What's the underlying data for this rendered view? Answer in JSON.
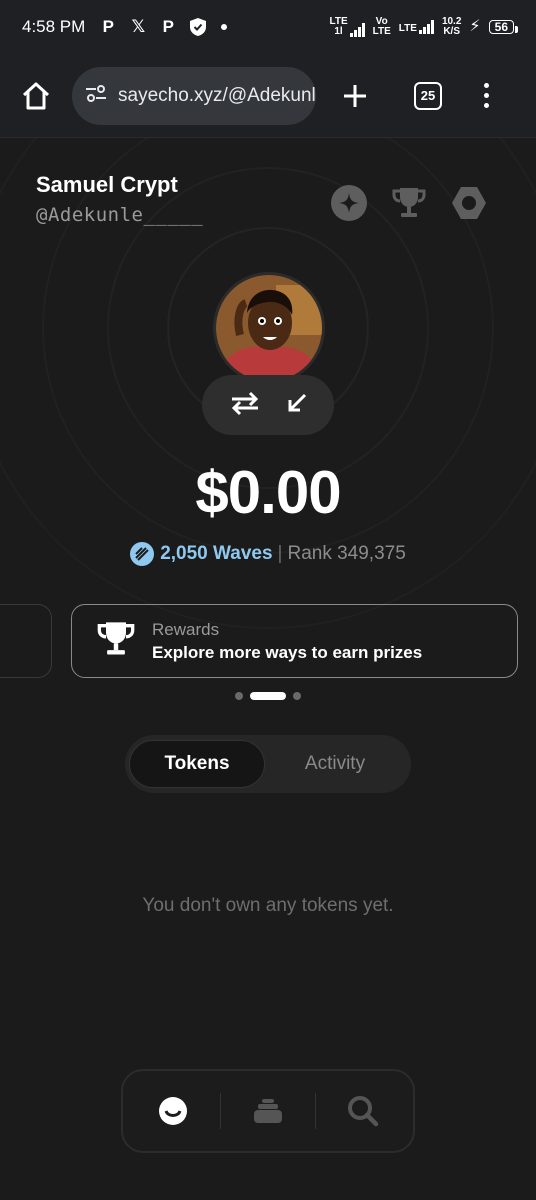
{
  "status_bar": {
    "time": "4:58 PM",
    "notif_icons": [
      "p-icon",
      "x-icon",
      "p-icon",
      "shield-icon",
      "dot-icon"
    ],
    "net1": "LTE",
    "net1_sub": "1l",
    "net2_top": "Vo",
    "net2_bottom": "LTE",
    "net3": "LTE",
    "speed_value": "10.2",
    "speed_unit": "K/S",
    "battery": "56"
  },
  "browser": {
    "url": "sayecho.xyz/@Adekunle_____",
    "tab_count": "25"
  },
  "profile": {
    "name": "Samuel Crypt",
    "handle": "@Adekunle_____",
    "balance": "$0.00",
    "waves": "2,050 Waves",
    "separator": "|",
    "rank": "Rank 349,375"
  },
  "rewards_card": {
    "label": "Rewards",
    "description": "Explore more ways to earn prizes"
  },
  "tabs": [
    {
      "label": "Tokens",
      "active": true
    },
    {
      "label": "Activity",
      "active": false
    }
  ],
  "empty_state": "You don't own any tokens yet.",
  "colors": {
    "background": "#1b1b1b",
    "waves_accent": "#8fc9f0",
    "card_border": "#8a8a8a"
  }
}
